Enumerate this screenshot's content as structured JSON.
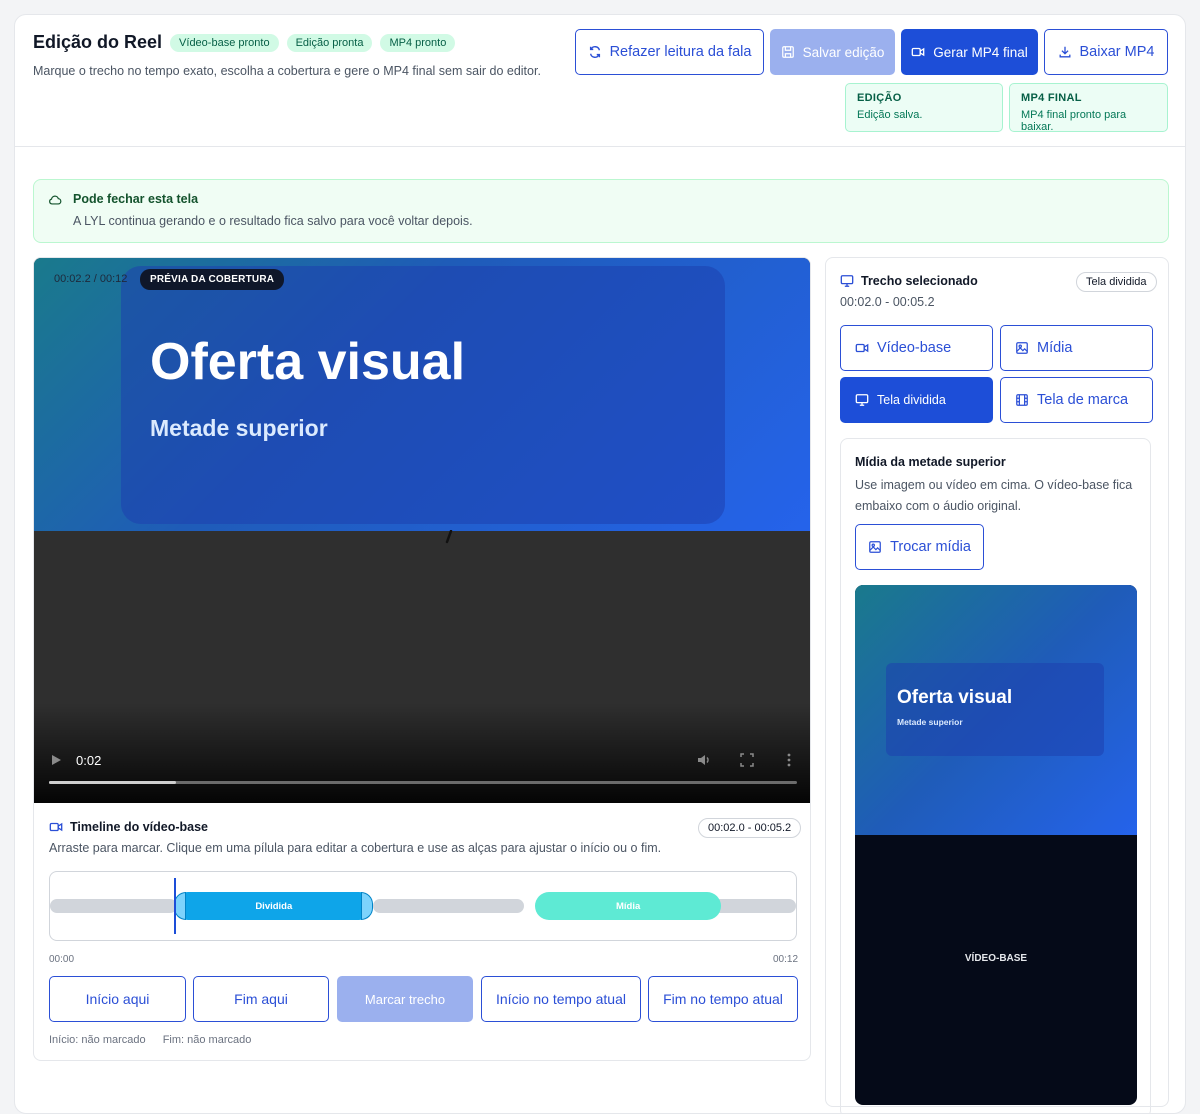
{
  "header": {
    "title": "Edição do Reel",
    "chips": [
      "Vídeo-base pronto",
      "Edição pronta",
      "MP4 pronto"
    ],
    "subtitle": "Marque o trecho no tempo exato, escolha a cobertura e gere o MP4 final sem sair do editor.",
    "buttons": {
      "redo": "Refazer leitura da fala",
      "save": "Salvar edição",
      "generate": "Gerar MP4 final",
      "download": "Baixar MP4"
    },
    "status": [
      {
        "label": "EDIÇÃO",
        "value": "Edição salva."
      },
      {
        "label": "MP4 FINAL",
        "value": "MP4 final pronto para baixar."
      }
    ]
  },
  "banner": {
    "title": "Pode fechar esta tela",
    "text": "A LYL continua gerando e o resultado fica salvo para você voltar depois."
  },
  "preview": {
    "time_overlay": "00:02.2 / 00:12",
    "badge": "PRÉVIA DA COBERTURA",
    "headline": "Oferta visual",
    "subheadline": "Metade superior",
    "player_time": "0:02",
    "progress": 0.17
  },
  "timeline": {
    "title": "Timeline do vídeo-base",
    "range": "00:02.0 - 00:05.2",
    "description": "Arraste para marcar. Clique em uma pílula para editar a cobertura e use as alças para ajustar o início ou o fim.",
    "duration_s": 12,
    "segments": [
      {
        "label": "Dividida",
        "start_s": 2.0,
        "end_s": 5.2,
        "color": "#0ea5e9"
      },
      {
        "label": "Mídia",
        "start_s": 7.8,
        "end_s": 10.8,
        "color": "#5eead4"
      }
    ],
    "playhead_s": 2.0,
    "start_label": "00:00",
    "end_label": "00:12",
    "actions": {
      "start_here": "Início aqui",
      "end_here": "Fim aqui",
      "mark": "Marcar trecho",
      "start_current": "Início no tempo atual",
      "end_current": "Fim no tempo atual"
    },
    "marks": {
      "start": "Início: não marcado",
      "end": "Fim: não marcado"
    }
  },
  "panel": {
    "title": "Trecho selecionado",
    "badge": "Tela dividida",
    "range": "00:02.0 - 00:05.2",
    "options": {
      "video": "Vídeo-base",
      "media": "Mídia",
      "split": "Tela dividida",
      "brand": "Tela de marca"
    },
    "media_section": {
      "title": "Mídia da metade superior",
      "description": "Use imagem ou vídeo em cima. O vídeo-base fica embaixo com o áudio original.",
      "button": "Trocar mídia"
    },
    "thumb": {
      "headline": "Oferta visual",
      "sub": "Metade superior",
      "bottom_label": "VÍDEO-BASE"
    }
  },
  "colors": {
    "accent": "#1d4ed8",
    "success_bg": "#ecfdf5"
  }
}
